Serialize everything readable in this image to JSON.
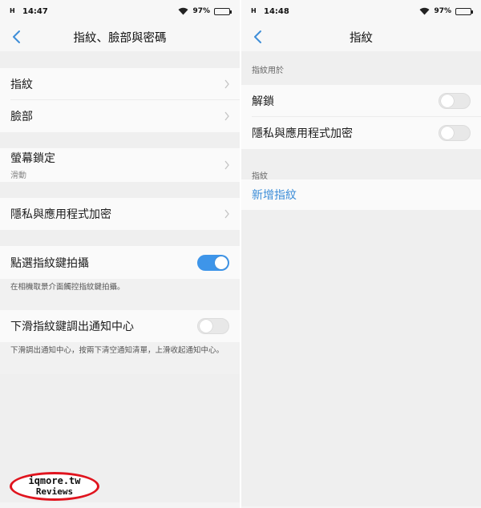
{
  "left": {
    "status": {
      "signal": "H",
      "time": "14:47",
      "battery": "97%"
    },
    "title": "指紋、臉部與密碼",
    "items": {
      "fingerprint": "指紋",
      "face": "臉部",
      "screen_lock": "螢幕鎖定",
      "screen_lock_sub": "滑動",
      "privacy": "隱私與應用程式加密",
      "tap_shoot": "點選指紋鍵拍攝",
      "tap_shoot_note": "在相機取景介面觸控指紋鍵拍攝。",
      "swipe_notify": "下滑指紋鍵調出通知中心",
      "swipe_notify_note": "下滑調出通知中心，按兩下清空通知清單，上滑收起通知中心。"
    },
    "toggles": {
      "tap_shoot": true,
      "swipe_notify": false
    }
  },
  "right": {
    "status": {
      "signal": "H",
      "time": "14:48",
      "battery": "97%"
    },
    "title": "指紋",
    "section_use": "指紋用於",
    "unlock": "解鎖",
    "privacy": "隱私與應用程式加密",
    "section_fp": "指紋",
    "add_fp": "新增指紋",
    "toggles": {
      "unlock": false,
      "privacy": false
    }
  },
  "watermark": {
    "line1": "iqmore.tw",
    "line2": "Reviews"
  },
  "colors": {
    "accent": "#3e95e9",
    "link": "#3e8ed8",
    "watermark": "#e0141e"
  },
  "icons": [
    "back-arrow-icon",
    "chevron-right-icon",
    "wifi-icon",
    "battery-icon"
  ]
}
